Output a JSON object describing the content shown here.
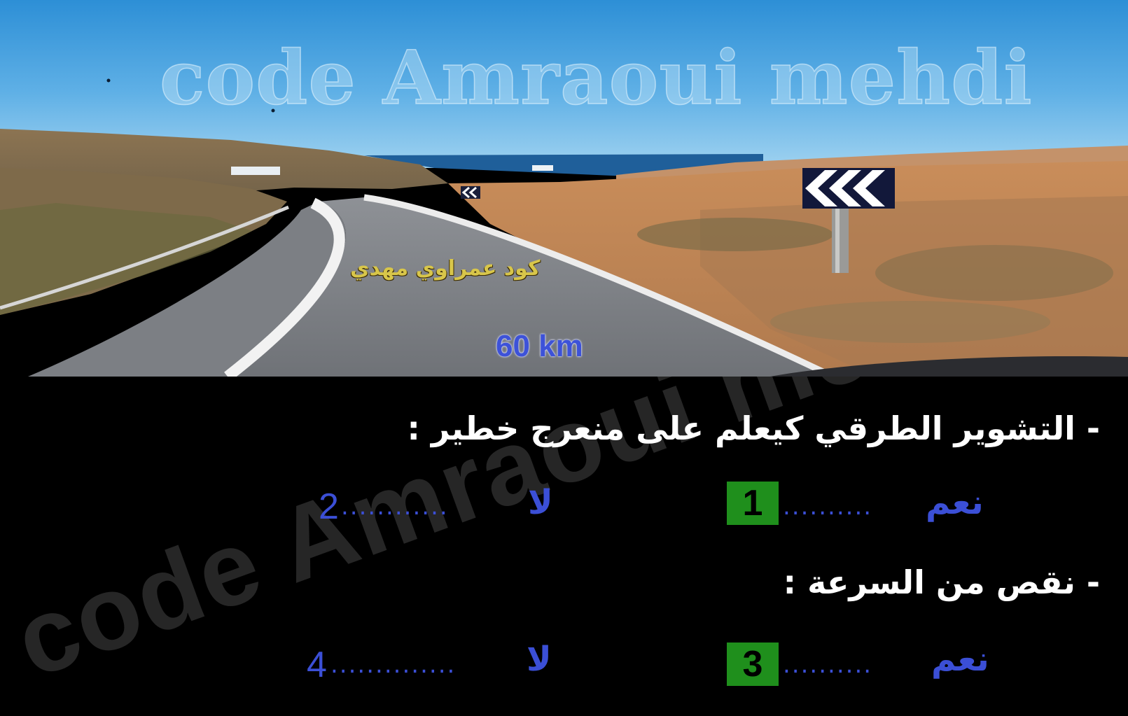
{
  "watermark_top": "code Amraoui mehdi",
  "watermark_arabic": "كود عمراوي مهدي",
  "speed": "60 km",
  "watermark_diagonal": "code Amraoui mehdi",
  "questions": [
    {
      "text": "- التشوير الطرقي كيعلم على منعرج خطير :",
      "yes_label": "نعم",
      "yes_number": "1",
      "no_label": "لا",
      "no_number": "2",
      "dots_yes": "..........",
      "dots_no": "............"
    },
    {
      "text": "- نقص من السرعة :",
      "yes_label": "نعم",
      "yes_number": "3",
      "no_label": "لا",
      "no_number": "4",
      "dots_yes": "..........",
      "dots_no": ".............."
    }
  ],
  "colors": {
    "answer_blue": "#3b4fd6",
    "selected_green": "#1f8f1c",
    "speed_blue": "#3d52d8",
    "caption_gold": "#d8c64a"
  },
  "icons": [
    "chevron-road-sign-large",
    "chevron-road-sign-small"
  ]
}
